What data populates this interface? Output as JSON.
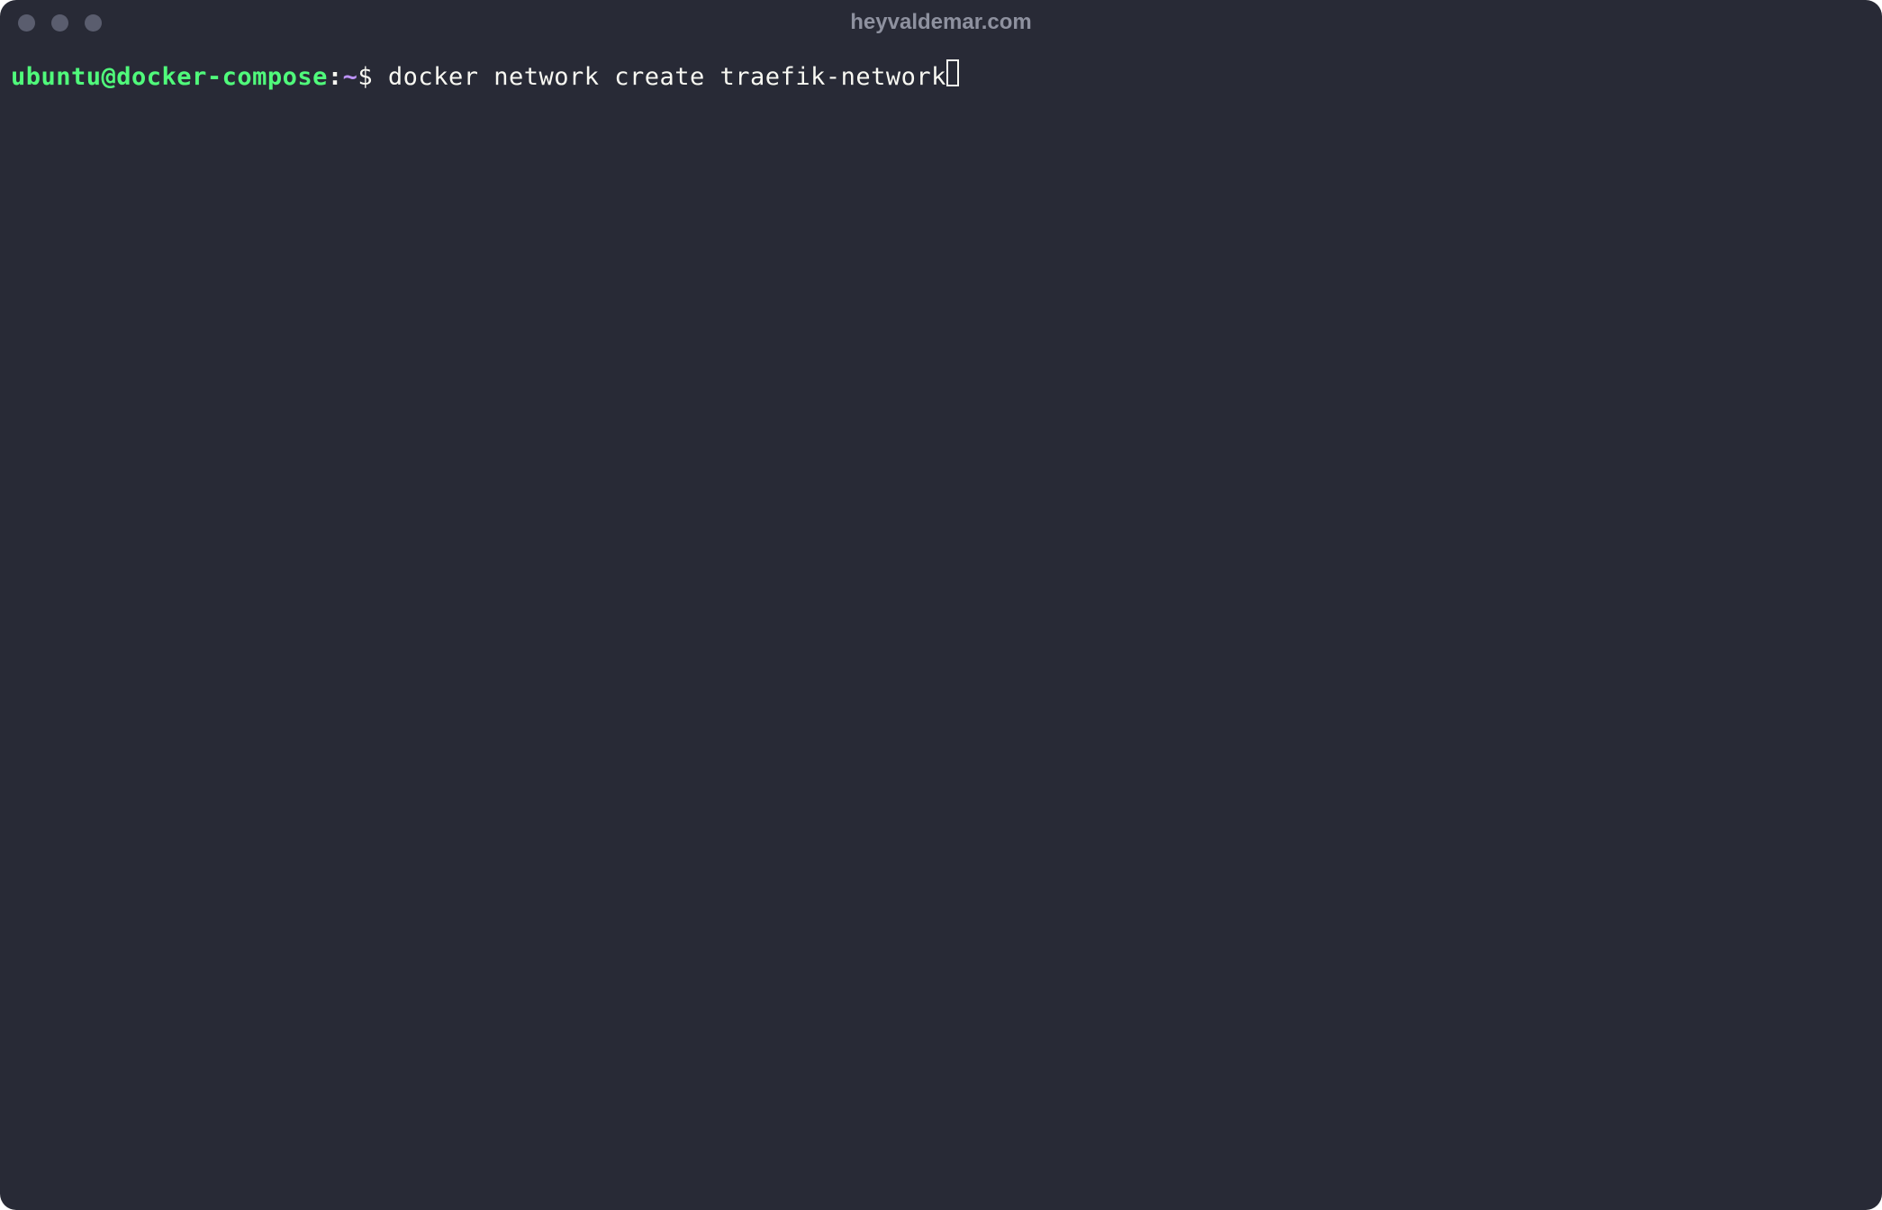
{
  "window": {
    "title": "heyvaldemar.com"
  },
  "traffic_lights": {
    "close": "close-icon",
    "minimize": "minimize-icon",
    "maximize": "maximize-icon"
  },
  "terminal": {
    "prompt": {
      "user_host": "ubuntu@docker-compose",
      "colon": ":",
      "path": "~",
      "symbol": "$ "
    },
    "command": "docker network create traefik-network"
  },
  "colors": {
    "background": "#282a36",
    "prompt_green": "#50fa7b",
    "prompt_purple": "#bd93f9",
    "text": "#f8f8f2",
    "title": "#8e919f",
    "traffic_light": "#5a5d6e"
  }
}
